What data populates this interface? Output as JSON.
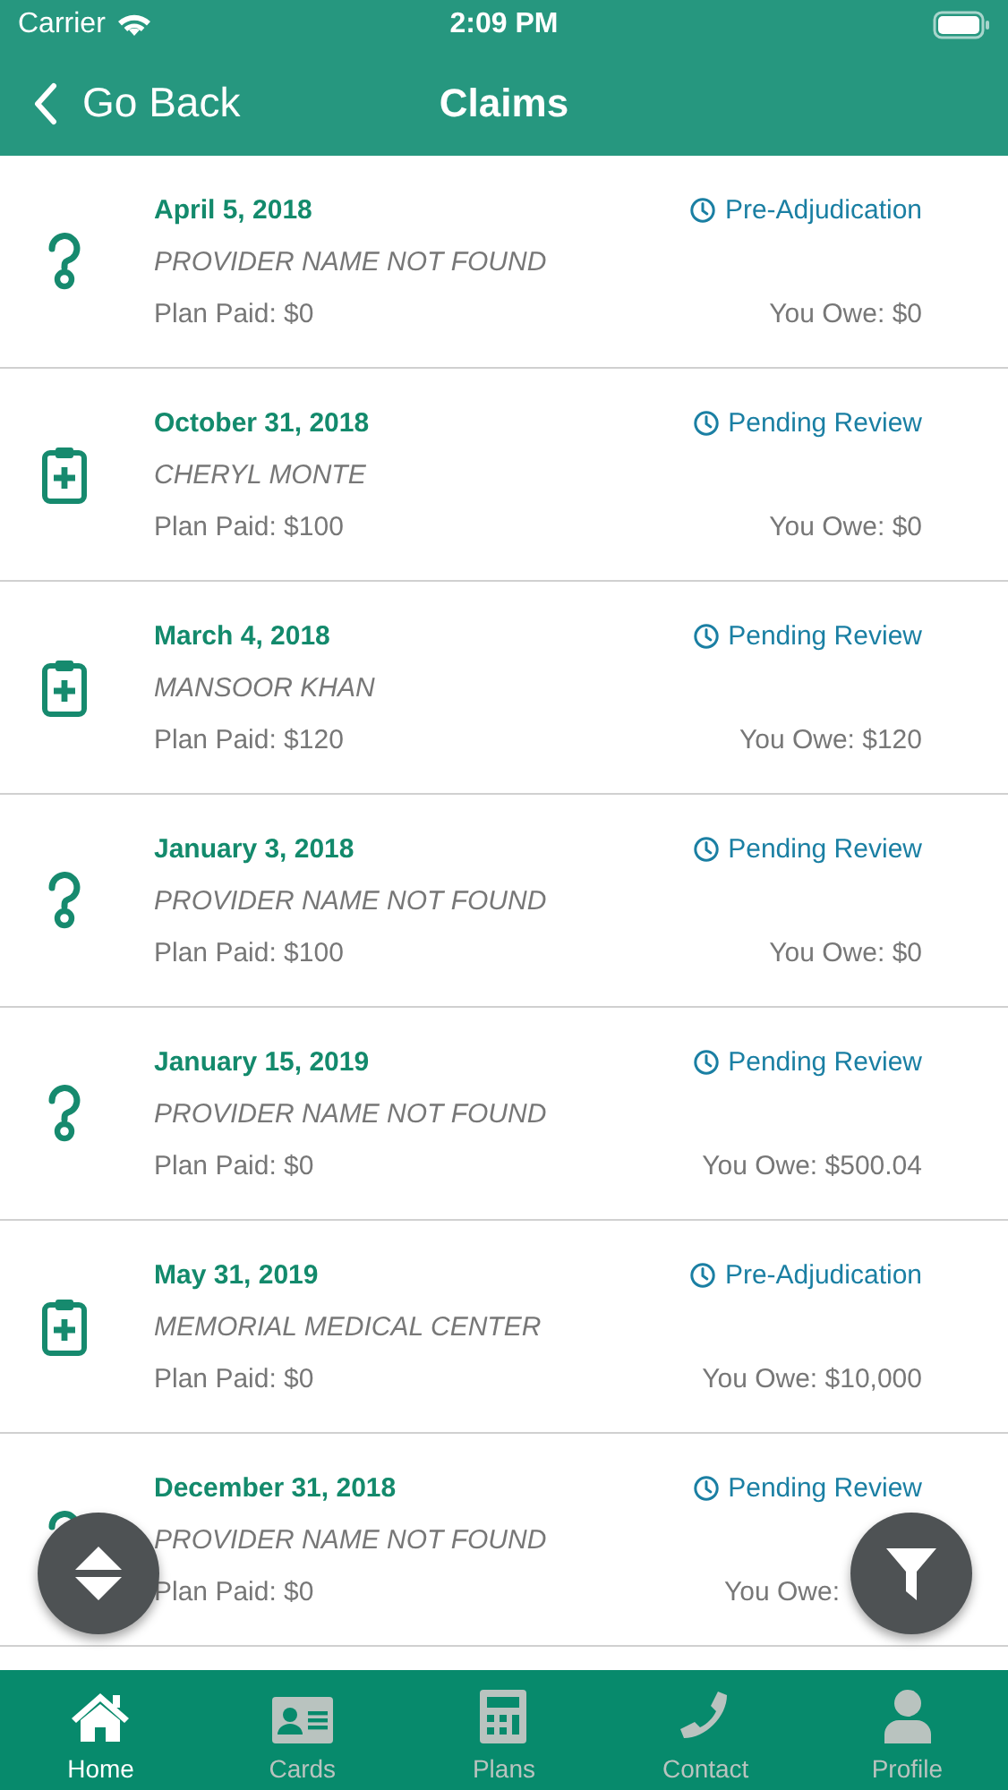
{
  "status_bar": {
    "carrier": "Carrier",
    "time": "2:09 PM"
  },
  "nav": {
    "back": "Go Back",
    "title": "Claims"
  },
  "claims": [
    {
      "kind": "unknown",
      "date": "April 5, 2018",
      "status": "Pre-Adjudication",
      "provider": "PROVIDER NAME NOT FOUND",
      "plan_paid": "Plan Paid: $0",
      "you_owe": "You Owe: $0"
    },
    {
      "kind": "provider",
      "date": "October 31, 2018",
      "status": "Pending Review",
      "provider": "CHERYL MONTE",
      "plan_paid": "Plan Paid: $100",
      "you_owe": "You Owe: $0"
    },
    {
      "kind": "provider",
      "date": "March 4, 2018",
      "status": "Pending Review",
      "provider": "MANSOOR KHAN",
      "plan_paid": "Plan Paid: $120",
      "you_owe": "You Owe: $120"
    },
    {
      "kind": "unknown",
      "date": "January 3, 2018",
      "status": "Pending Review",
      "provider": "PROVIDER NAME NOT FOUND",
      "plan_paid": "Plan Paid: $100",
      "you_owe": "You Owe: $0"
    },
    {
      "kind": "unknown",
      "date": "January 15, 2019",
      "status": "Pending Review",
      "provider": "PROVIDER NAME NOT FOUND",
      "plan_paid": "Plan Paid: $0",
      "you_owe": "You Owe: $500.04"
    },
    {
      "kind": "provider",
      "date": "May 31, 2019",
      "status": "Pre-Adjudication",
      "provider": "MEMORIAL MEDICAL CENTER",
      "plan_paid": "Plan Paid: $0",
      "you_owe": "You Owe: $10,000"
    },
    {
      "kind": "unknown",
      "date": "December 31, 2018",
      "status": "Pending Review",
      "provider": "PROVIDER NAME NOT FOUND",
      "plan_paid": "Plan Paid: $0",
      "you_owe": "You Owe:"
    }
  ],
  "tabs": [
    {
      "kind": "home",
      "label": "Home",
      "selected": true
    },
    {
      "kind": "cards",
      "label": "Cards",
      "selected": false
    },
    {
      "kind": "plans",
      "label": "Plans",
      "selected": false
    },
    {
      "kind": "contact",
      "label": "Contact",
      "selected": false
    },
    {
      "kind": "profile",
      "label": "Profile",
      "selected": false
    }
  ]
}
